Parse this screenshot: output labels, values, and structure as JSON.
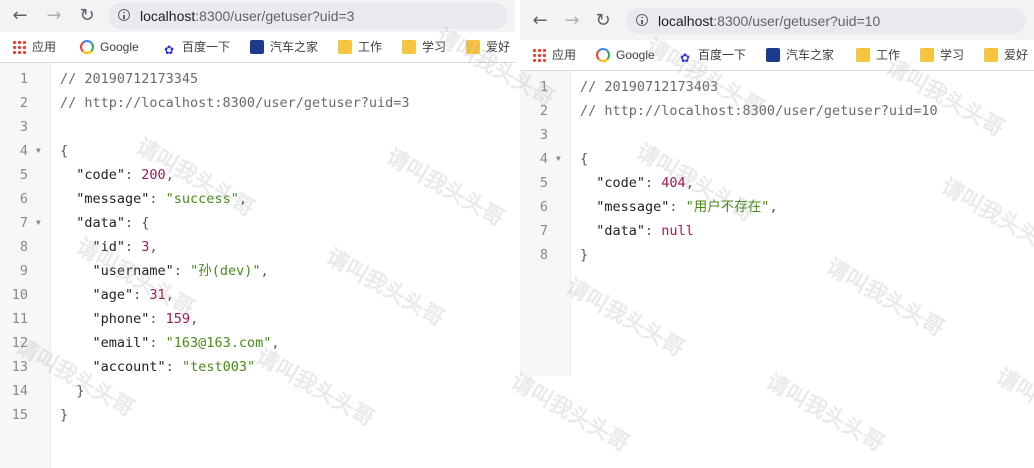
{
  "left": {
    "url_host": "localhost",
    "url_rest": ":8300/user/getuser?uid=3",
    "bookmarks": [
      "应用",
      "Google",
      "百度一下",
      "汽车之家",
      "工作",
      "学习",
      "爱好"
    ],
    "lines": [
      {
        "n": "1",
        "t": [
          [
            "c-comment",
            "// 20190712173345"
          ]
        ]
      },
      {
        "n": "2",
        "t": [
          [
            "c-comment",
            "// http://localhost:8300/user/getuser?uid=3"
          ]
        ]
      },
      {
        "n": "3",
        "t": []
      },
      {
        "n": "4",
        "fold": true,
        "t": [
          [
            "c-punc",
            "{"
          ]
        ]
      },
      {
        "n": "5",
        "t": [
          [
            "c-key",
            "  \"code\""
          ],
          [
            "c-punc",
            ": "
          ],
          [
            "c-num",
            "200"
          ],
          [
            "c-punc",
            ","
          ]
        ]
      },
      {
        "n": "6",
        "t": [
          [
            "c-key",
            "  \"message\""
          ],
          [
            "c-punc",
            ": "
          ],
          [
            "c-str",
            "\"success\""
          ],
          [
            "c-punc",
            ","
          ]
        ]
      },
      {
        "n": "7",
        "fold": true,
        "t": [
          [
            "c-key",
            "  \"data\""
          ],
          [
            "c-punc",
            ": {"
          ]
        ]
      },
      {
        "n": "8",
        "t": [
          [
            "c-key",
            "    \"id\""
          ],
          [
            "c-punc",
            ": "
          ],
          [
            "c-num",
            "3"
          ],
          [
            "c-punc",
            ","
          ]
        ]
      },
      {
        "n": "9",
        "t": [
          [
            "c-key",
            "    \"username\""
          ],
          [
            "c-punc",
            ": "
          ],
          [
            "c-str",
            "\"孙(dev)\""
          ],
          [
            "c-punc",
            ","
          ]
        ]
      },
      {
        "n": "10",
        "t": [
          [
            "c-key",
            "    \"age\""
          ],
          [
            "c-punc",
            ": "
          ],
          [
            "c-num",
            "31"
          ],
          [
            "c-punc",
            ","
          ]
        ]
      },
      {
        "n": "11",
        "t": [
          [
            "c-key",
            "    \"phone\""
          ],
          [
            "c-punc",
            ": "
          ],
          [
            "c-num",
            "159"
          ],
          [
            "c-punc",
            ","
          ]
        ]
      },
      {
        "n": "12",
        "t": [
          [
            "c-key",
            "    \"email\""
          ],
          [
            "c-punc",
            ": "
          ],
          [
            "c-str",
            "\"163@163.com\""
          ],
          [
            "c-punc",
            ","
          ]
        ]
      },
      {
        "n": "13",
        "t": [
          [
            "c-key",
            "    \"account\""
          ],
          [
            "c-punc",
            ": "
          ],
          [
            "c-str",
            "\"test003\""
          ]
        ]
      },
      {
        "n": "14",
        "t": [
          [
            "c-punc",
            "  }"
          ]
        ]
      },
      {
        "n": "15",
        "t": [
          [
            "c-punc",
            "}"
          ]
        ]
      }
    ]
  },
  "right": {
    "url_host": "localhost",
    "url_rest": ":8300/user/getuser?uid=10",
    "bookmarks": [
      "应用",
      "Google",
      "百度一下",
      "汽车之家",
      "工作",
      "学习",
      "爱好"
    ],
    "lines": [
      {
        "n": "1",
        "t": [
          [
            "c-comment",
            "// 20190712173403"
          ]
        ]
      },
      {
        "n": "2",
        "t": [
          [
            "c-comment",
            "// http://localhost:8300/user/getuser?uid=10"
          ]
        ]
      },
      {
        "n": "3",
        "t": []
      },
      {
        "n": "4",
        "fold": true,
        "t": [
          [
            "c-punc",
            "{"
          ]
        ]
      },
      {
        "n": "5",
        "t": [
          [
            "c-key",
            "  \"code\""
          ],
          [
            "c-punc",
            ": "
          ],
          [
            "c-num",
            "404"
          ],
          [
            "c-punc",
            ","
          ]
        ]
      },
      {
        "n": "6",
        "t": [
          [
            "c-key",
            "  \"message\""
          ],
          [
            "c-punc",
            ": "
          ],
          [
            "c-str",
            "\"用户不存在\""
          ],
          [
            "c-punc",
            ","
          ]
        ]
      },
      {
        "n": "7",
        "t": [
          [
            "c-key",
            "  \"data\""
          ],
          [
            "c-punc",
            ": "
          ],
          [
            "c-null",
            "null"
          ]
        ]
      },
      {
        "n": "8",
        "t": [
          [
            "c-punc",
            "}"
          ]
        ]
      }
    ]
  },
  "watermark": "请叫我头头哥",
  "icons": {
    "back": "back-arrow-icon",
    "forward": "forward-arrow-icon",
    "reload": "reload-icon",
    "info": "info-icon"
  }
}
